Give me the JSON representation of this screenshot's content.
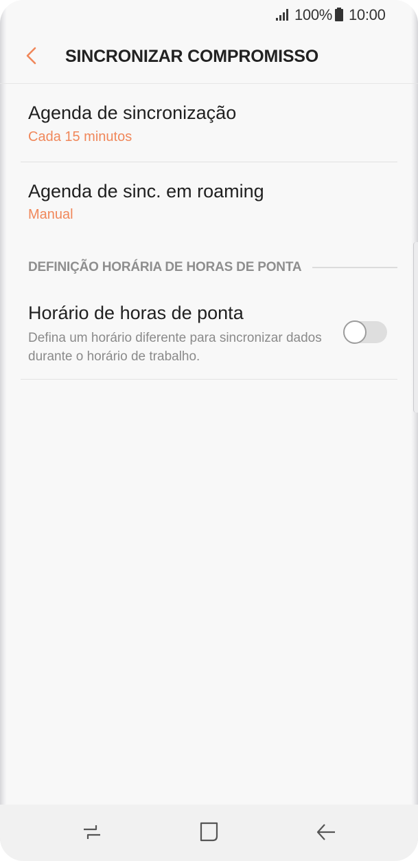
{
  "status_bar": {
    "signal_icon": "signal-bars-icon",
    "battery_percent": "100%",
    "battery_icon": "battery-full-icon",
    "time": "10:00"
  },
  "header": {
    "back_icon": "chevron-left-icon",
    "title": "SINCRONIZAR COMPROMISSO"
  },
  "settings": {
    "sync_schedule": {
      "title": "Agenda de sincronização",
      "value": "Cada 15 minutos"
    },
    "roaming_schedule": {
      "title": "Agenda de sinc. em roaming",
      "value": "Manual"
    },
    "peak_section": {
      "header": "DEFINIÇÃO HORÁRIA DE HORAS DE PONTA",
      "item": {
        "title": "Horário de horas de ponta",
        "description": "Defina um horário diferente para sincronizar dados durante o horário de trabalho.",
        "toggle_on": false
      }
    }
  },
  "nav_bar": {
    "recents_icon": "recent-apps-icon",
    "home_icon": "home-icon",
    "back_icon": "back-arrow-icon"
  },
  "colors": {
    "accent": "#f0875a",
    "background": "#f8f8f8"
  }
}
